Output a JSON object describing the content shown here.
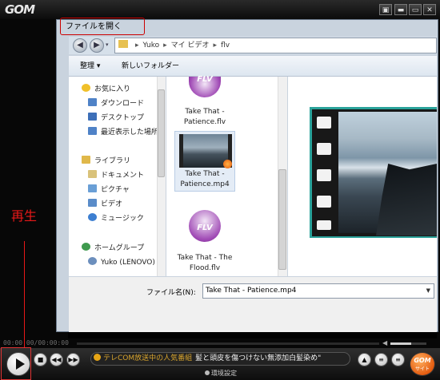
{
  "player": {
    "logo": "GOM",
    "window_buttons": [
      "▣",
      "▬",
      "▭",
      "✕"
    ],
    "timecode": "00:00:00/00:00:00",
    "ticker_prefix": "テレCOM放送中の人気番組",
    "ticker_message": "髪と頭皮を傷つけない無添加白髪染め\"",
    "settings_label": "環境設定",
    "gom_word": "GOM",
    "gom_sub": "サイト",
    "volume_level": 0.58
  },
  "dialog": {
    "title": "ファイルを開く",
    "breadcrumb": [
      "Yuko",
      "マイ ビデオ",
      "flv"
    ],
    "toolbar": {
      "organize": "整理 ▾",
      "new_folder": "新しいフォルダー"
    },
    "nav_items": [
      {
        "label": "お気に入り",
        "icon": "star-icon",
        "color": "#f0c02a"
      },
      {
        "label": "ダウンロード",
        "icon": "download-folder-icon",
        "color": "#4f82c7"
      },
      {
        "label": "デスクトップ",
        "icon": "desktop-icon",
        "color": "#3d6fb8"
      },
      {
        "label": "最近表示した場所",
        "icon": "recent-places-icon",
        "color": "#4f82c7"
      },
      {
        "label": "ライブラリ",
        "icon": "library-icon",
        "color": "#e0b84a"
      },
      {
        "label": "ドキュメント",
        "icon": "documents-icon",
        "color": "#d9c27a"
      },
      {
        "label": "ピクチャ",
        "icon": "pictures-icon",
        "color": "#6a9fd6"
      },
      {
        "label": "ビデオ",
        "icon": "videos-icon",
        "color": "#5a8cc9"
      },
      {
        "label": "ミュージック",
        "icon": "music-icon",
        "color": "#3d7fd1"
      },
      {
        "label": "ホームグループ",
        "icon": "homegroup-icon",
        "color": "#3f9a4e"
      },
      {
        "label": "Yuko (LENOVO)",
        "icon": "user-icon",
        "color": "#6c8fbd"
      }
    ],
    "files": [
      {
        "name": "Take That - Patience.flv",
        "icon": "flv-icon",
        "badge": "FLV"
      },
      {
        "name": "Take That - Patience.mp4",
        "icon": "video-thumbnail-icon"
      },
      {
        "name": "Take That - The Flood.flv",
        "icon": "flv-icon",
        "badge": "FLV"
      }
    ],
    "filename_label": "ファイル名(N):",
    "filename_value": "Take That - Patience.mp4"
  },
  "annotation": {
    "label": "再生"
  }
}
